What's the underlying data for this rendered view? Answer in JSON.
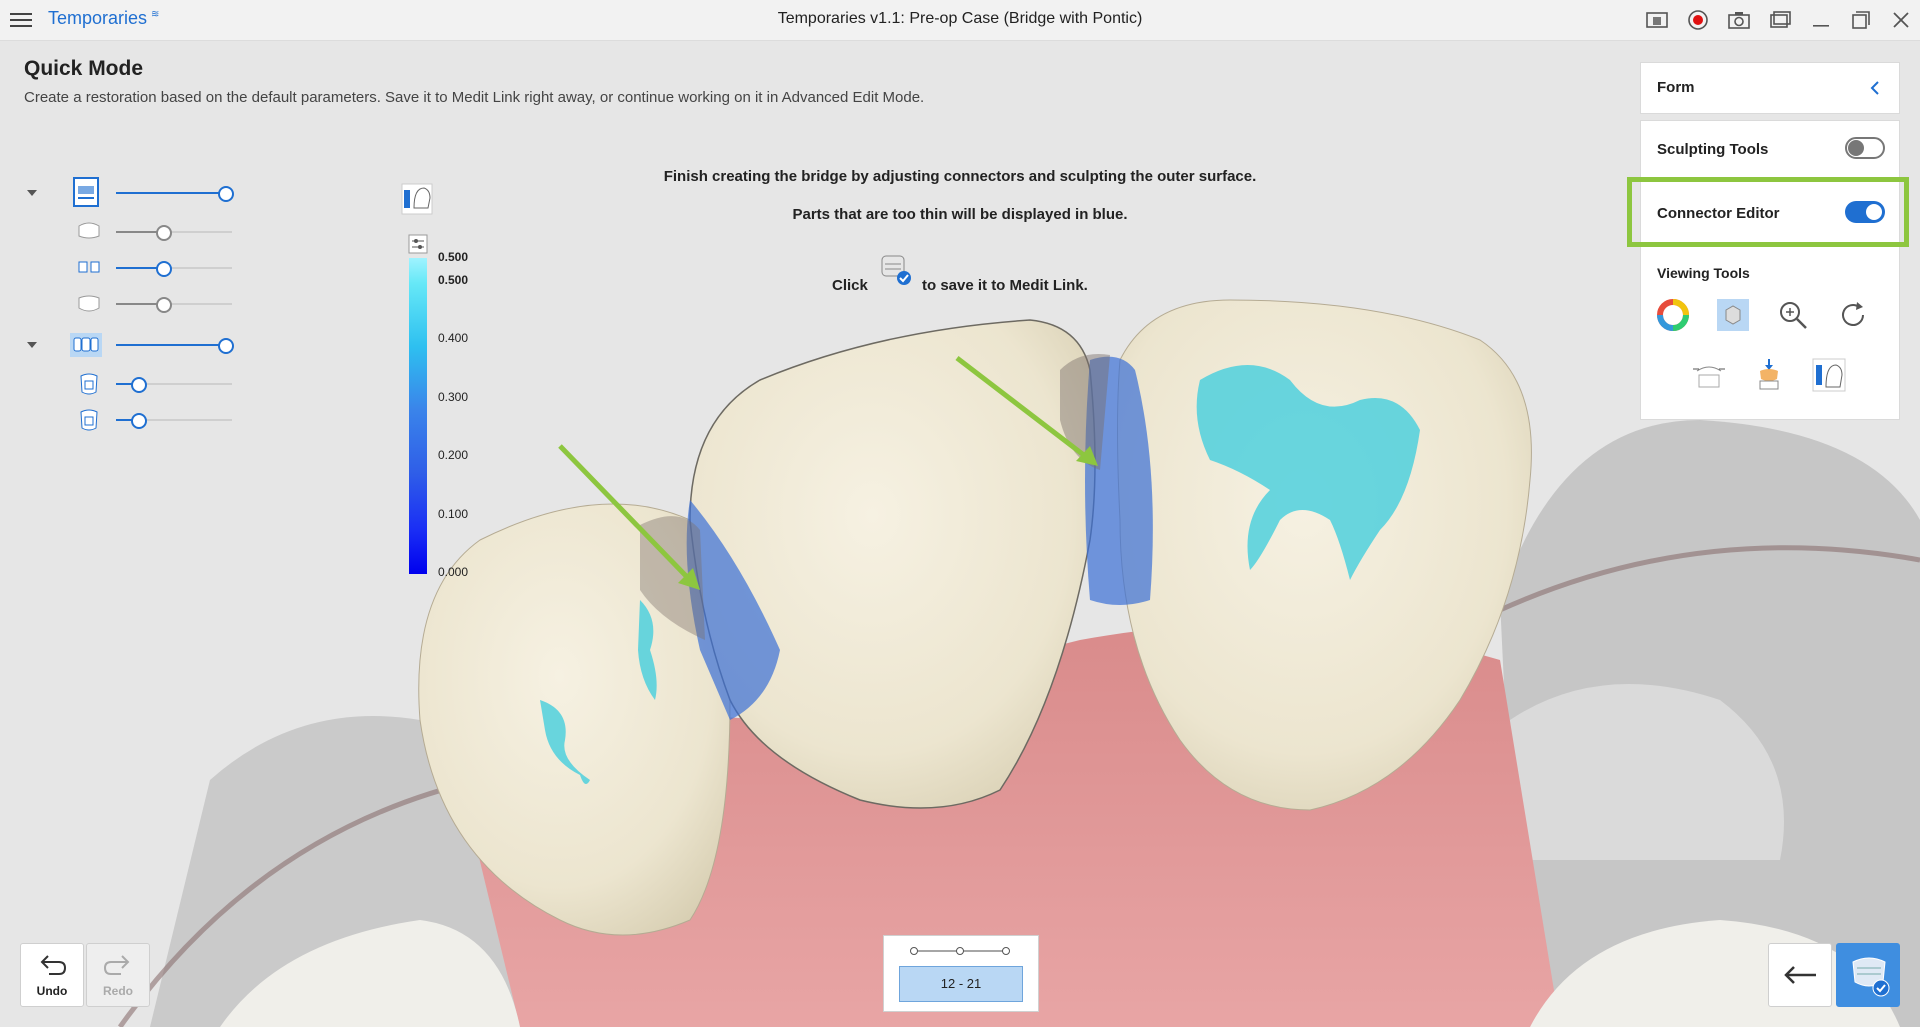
{
  "titlebar": {
    "app_name": "Temporaries",
    "window_title": "Temporaries v1.1: Pre-op Case (Bridge with Pontic)"
  },
  "mode": {
    "title": "Quick Mode",
    "description": "Create a restoration based on the default parameters. Save it to Medit Link right away, or continue working on it in Advanced Edit Mode."
  },
  "instructions": {
    "line1": "Finish creating the bridge by adjusting connectors and sculpting the outer surface.",
    "line2": "Parts that are too thin will be displayed in blue.",
    "click_word": "Click",
    "save_text": "to save it to Medit Link."
  },
  "sliders": [
    {
      "name": "group-1-opacity",
      "value": 1.0
    },
    {
      "name": "item-1a-opacity",
      "value": 0.4
    },
    {
      "name": "item-1b-opacity",
      "value": 0.4
    },
    {
      "name": "item-1c-opacity",
      "value": 0.4
    },
    {
      "name": "group-2-opacity",
      "value": 1.0
    },
    {
      "name": "item-2a-opacity",
      "value": 0.18
    },
    {
      "name": "item-2b-opacity",
      "value": 0.18
    }
  ],
  "legend": {
    "labels": [
      "0.500",
      "0.500",
      "0.400",
      "0.300",
      "0.200",
      "0.100",
      "0.000"
    ]
  },
  "panel": {
    "form_label": "Form",
    "sculpting_label": "Sculpting Tools",
    "sculpting_on": false,
    "connector_label": "Connector Editor",
    "connector_on": true,
    "viewing_label": "Viewing Tools"
  },
  "bottom": {
    "undo_label": "Undo",
    "redo_label": "Redo",
    "range_label": "12 - 21"
  },
  "colors": {
    "accent": "#1f6fd1",
    "highlight": "#8dc63f",
    "arrow": "#8dc63f"
  }
}
